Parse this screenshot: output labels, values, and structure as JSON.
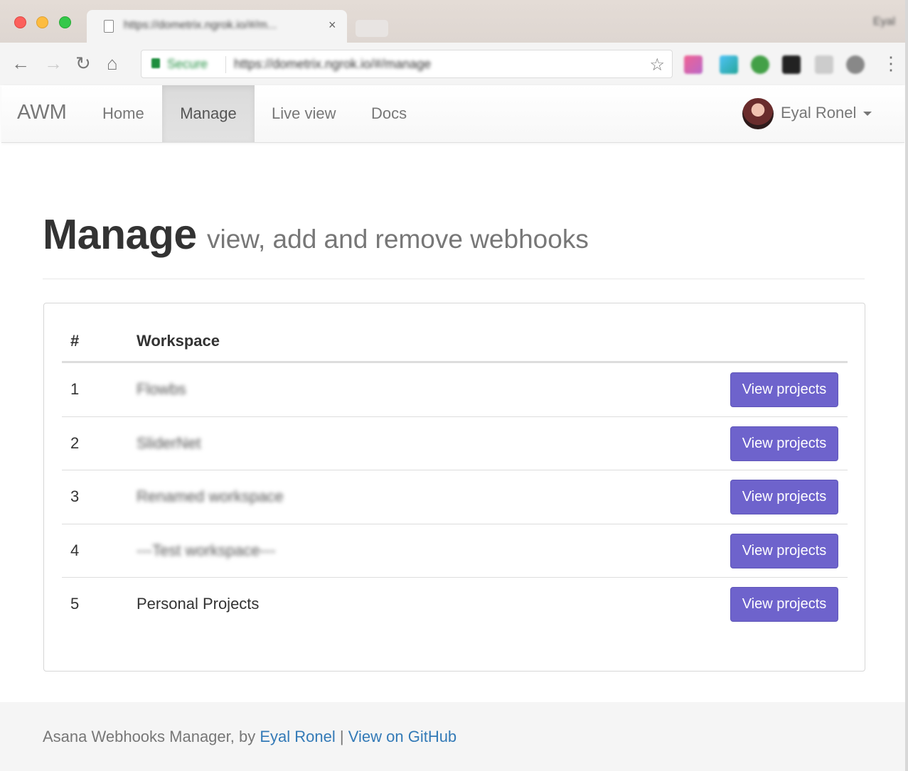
{
  "browser": {
    "tab_title": "https://dometrix.ngrok.io/#/m...",
    "tab_close": "×",
    "profile_name": "Eyal",
    "secure_label": "Secure",
    "url": "https://dometrix.ngrok.io/#/manage"
  },
  "navbar": {
    "brand": "AWM",
    "links": [
      {
        "label": "Home"
      },
      {
        "label": "Manage",
        "active": true
      },
      {
        "label": "Live view"
      },
      {
        "label": "Docs"
      }
    ],
    "user_name": "Eyal Ronel"
  },
  "header": {
    "title": "Manage",
    "subtitle": "view, add and remove webhooks"
  },
  "table": {
    "columns": [
      "#",
      "Workspace"
    ],
    "rows": [
      {
        "num": "1",
        "workspace": "Flowbs",
        "action": "View projects"
      },
      {
        "num": "2",
        "workspace": "SliderNet",
        "action": "View projects"
      },
      {
        "num": "3",
        "workspace": "Renamed workspace",
        "action": "View projects"
      },
      {
        "num": "4",
        "workspace": "---Test workspace---",
        "action": "View projects"
      },
      {
        "num": "5",
        "workspace": "Personal Projects",
        "action": "View projects"
      }
    ]
  },
  "footer": {
    "prefix": "Asana Webhooks Manager, by",
    "author_link": "Eyal Ronel",
    "separator": "|",
    "github_link": "View on GitHub"
  },
  "colors": {
    "button": "#6e63cc",
    "link": "#337ab7",
    "secure": "#1e8e3e"
  }
}
